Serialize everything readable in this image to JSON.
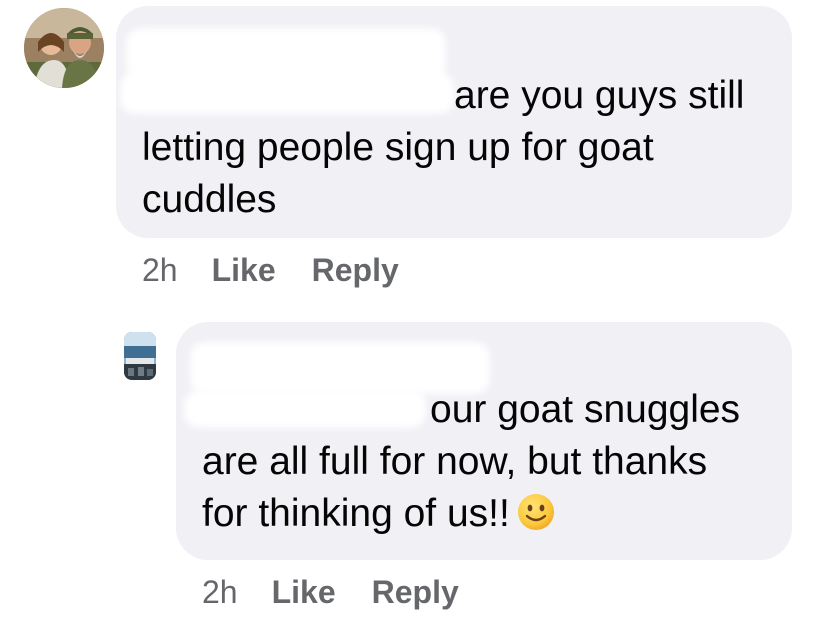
{
  "comments": [
    {
      "avatar_icon": "user-avatar-photo",
      "author_name_redacted": true,
      "lines": [
        "are you guys still",
        "letting people sign up for goat",
        "cuddles"
      ],
      "time": "2h",
      "like_label": "Like",
      "reply_label": "Reply"
    }
  ],
  "replies": [
    {
      "avatar_icon": "page-avatar-photo",
      "author_name_redacted": true,
      "lines": [
        "our goat snuggles",
        "are all full for now, but thanks",
        "for thinking of us!!"
      ],
      "emoji_icon": "slightly-smiling-face-emoji",
      "time": "2h",
      "like_label": "Like",
      "reply_label": "Reply"
    }
  ],
  "colors": {
    "bubble_bg": "#f0f0f5",
    "text": "#050505",
    "meta": "#65676b"
  }
}
